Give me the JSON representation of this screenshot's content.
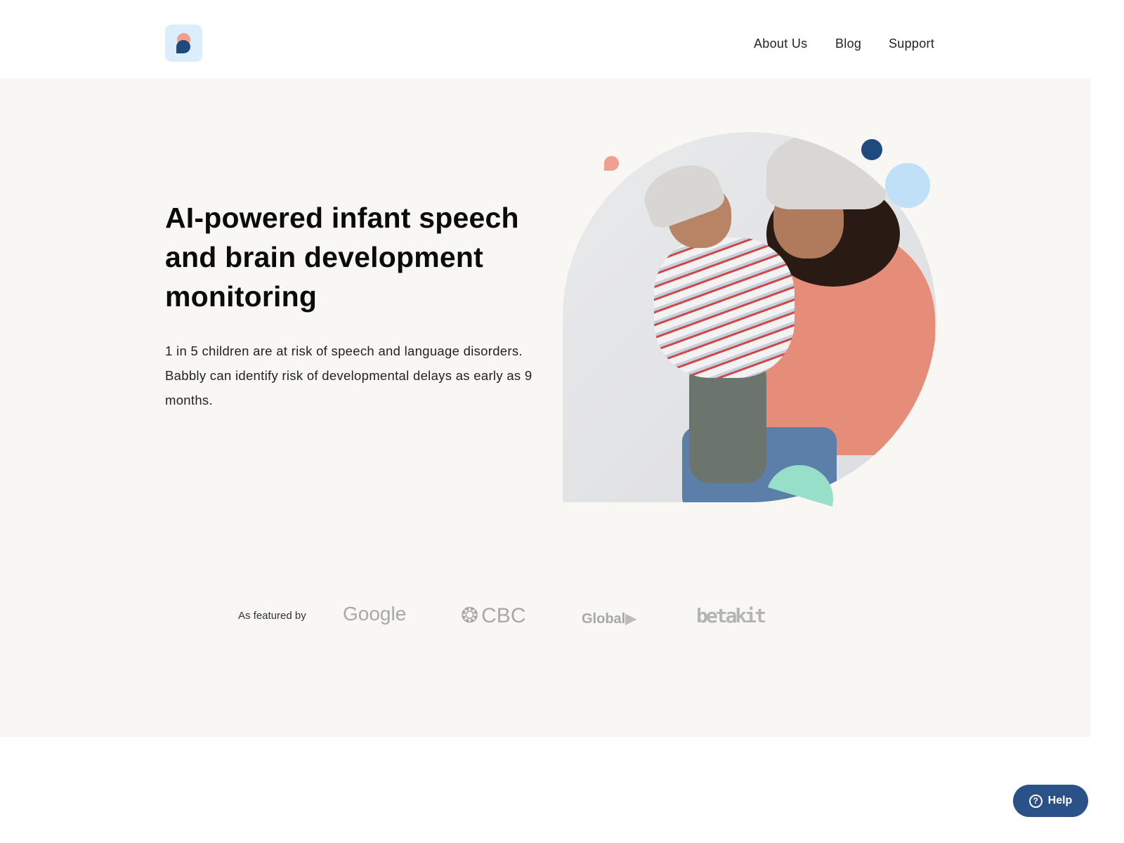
{
  "header": {
    "nav": [
      {
        "label": "About Us"
      },
      {
        "label": "Blog"
      },
      {
        "label": "Support"
      }
    ]
  },
  "hero": {
    "title": "AI-powered infant speech and brain development monitoring",
    "subtitle": "1 in 5 children are at risk of speech and language disorders. Babbly can identify risk of developmental delays as early as 9 months."
  },
  "featured": {
    "label": "As featured by",
    "brands": [
      "Google",
      "CBC",
      "Global",
      "betakit"
    ]
  },
  "help": {
    "label": "Help",
    "icon": "question-circle-icon"
  },
  "colors": {
    "brand_blue": "#1f4a80",
    "coral": "#f0a08e",
    "light_blue": "#bfe0f7",
    "mint": "#98dfc9",
    "hero_bg": "#f8f7f4"
  }
}
